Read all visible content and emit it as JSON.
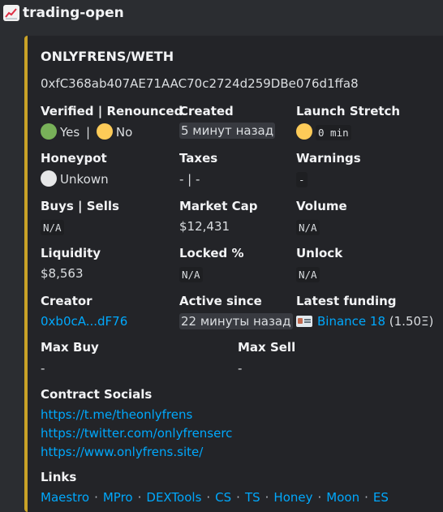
{
  "channel": {
    "name": "trading-open",
    "icon": "chart-increasing-icon"
  },
  "accent_color": "#c9a227",
  "embed": {
    "title": "ONLYFRENS/WETH",
    "address": "0xfC368ab407AE71AAC70c2724d259DBe076d1ffa8",
    "verified": {
      "label": "Verified | Renounced",
      "yes": "Yes",
      "sep": "|",
      "no": "No"
    },
    "created": {
      "label": "Created",
      "value": "5 минут назад"
    },
    "launch_stretch": {
      "label": "Launch Stretch",
      "value": "0 min"
    },
    "honeypot": {
      "label": "Honeypot",
      "value": "Unkown"
    },
    "taxes": {
      "label": "Taxes",
      "value": "- | -"
    },
    "warnings": {
      "label": "Warnings",
      "value": "-"
    },
    "buys_sells": {
      "label": "Buys | Sells",
      "value": "N/A"
    },
    "market_cap": {
      "label": "Market Cap",
      "value": "$12,431"
    },
    "volume": {
      "label": "Volume",
      "value": "N/A"
    },
    "liquidity": {
      "label": "Liquidity",
      "value": "$8,563"
    },
    "locked": {
      "label": "Locked %",
      "value": "N/A"
    },
    "unlock": {
      "label": "Unlock",
      "value": "N/A"
    },
    "creator": {
      "label": "Creator",
      "value": "0xb0cA...dF76"
    },
    "active_since": {
      "label": "Active since",
      "value": "22 минуты назад"
    },
    "latest_funding": {
      "label": "Latest funding",
      "link": "Binance 18",
      "amount": "(1.50Ξ)"
    },
    "max_buy": {
      "label": "Max Buy",
      "value": "-"
    },
    "max_sell": {
      "label": "Max Sell",
      "value": "-"
    },
    "socials": {
      "label": "Contract Socials",
      "links": [
        "https://t.me/theonlyfrens",
        "https://twitter.com/onlyfrenserc",
        "https://www.onlyfrens.site/"
      ]
    },
    "links": {
      "label": "Links",
      "items": [
        "Maestro",
        "MPro",
        "DEXTools",
        "CS",
        "TS",
        "Honey",
        "Moon",
        "ES"
      ],
      "separator": "·"
    }
  }
}
